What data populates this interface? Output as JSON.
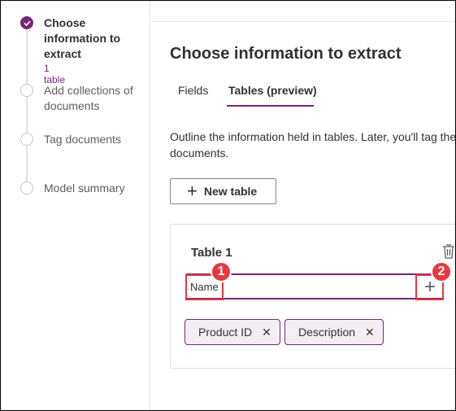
{
  "steps": [
    {
      "label": "Choose information to extract",
      "sub": "1 table",
      "state": "done"
    },
    {
      "label": "Add collections of documents",
      "state": "pending"
    },
    {
      "label": "Tag documents",
      "state": "pending"
    },
    {
      "label": "Model summary",
      "state": "pending"
    }
  ],
  "main": {
    "title": "Choose information to extract",
    "tabs": [
      {
        "label": "Fields",
        "selected": false
      },
      {
        "label": "Tables (preview)",
        "selected": true
      }
    ],
    "description_line1": "Outline the information held in tables. Later, you'll tag the",
    "description_line2": "documents.",
    "new_table_label": "New table"
  },
  "table_card": {
    "title": "Table 1",
    "input_value": "Name",
    "columns": [
      "Product ID",
      "Description"
    ]
  },
  "annotations": [
    {
      "number": "1",
      "target": "column-name-input"
    },
    {
      "number": "2",
      "target": "add-column-button"
    }
  ],
  "colors": {
    "accent": "#742774",
    "annotation": "#e8383d"
  }
}
